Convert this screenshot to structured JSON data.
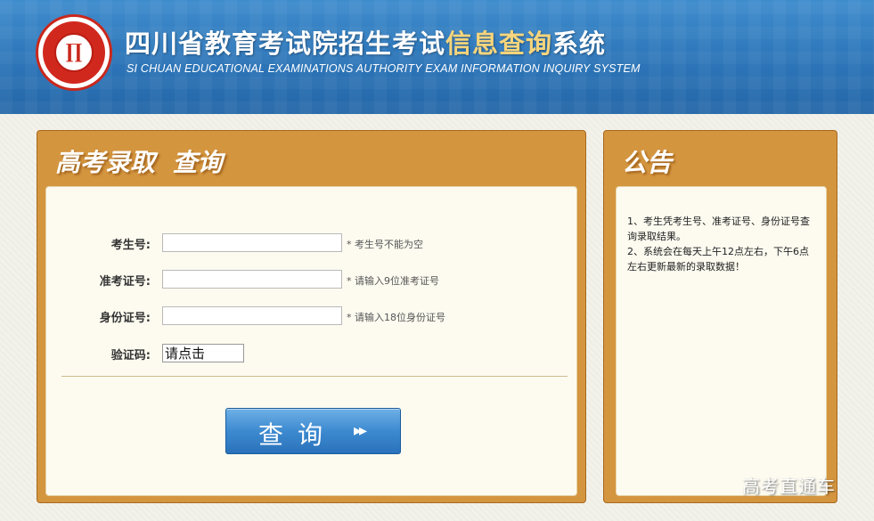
{
  "header": {
    "title_main": "四川省教育考试院招生考试",
    "title_highlight": "信息查询",
    "title_tail": "系统",
    "title_en": "SI CHUAN EDUCATIONAL EXAMINATIONS AUTHORITY EXAM INFORMATION INQUIRY SYSTEM",
    "logo_icon": "seal-logo-icon"
  },
  "query_panel": {
    "title": "高考录取  查询",
    "fields": [
      {
        "label": "考生号:",
        "value": "",
        "hint": "* 考生号不能为空"
      },
      {
        "label": "准考证号:",
        "value": "",
        "hint": "* 请输入9位准考证号"
      },
      {
        "label": "身份证号:",
        "value": "",
        "hint": "* 请输入18位身份证号"
      }
    ],
    "captcha_label": "验证码:",
    "captcha_text": "请点击",
    "button_label": "查询",
    "button_icon": "double-chevron-right-icon"
  },
  "notice_panel": {
    "title": "公告",
    "items": [
      "1、考生凭考生号、准考证号、身份证号查询录取结果。",
      "2、系统会在每天上午12点左右，下午6点左右更新最新的录取数据！"
    ]
  },
  "watermark": "高考直通车",
  "colors": {
    "header_blue": "#2c75b8",
    "panel_orange": "#d4953f",
    "title_highlight": "#f7d57c",
    "button_blue": "#3d8ad0"
  }
}
